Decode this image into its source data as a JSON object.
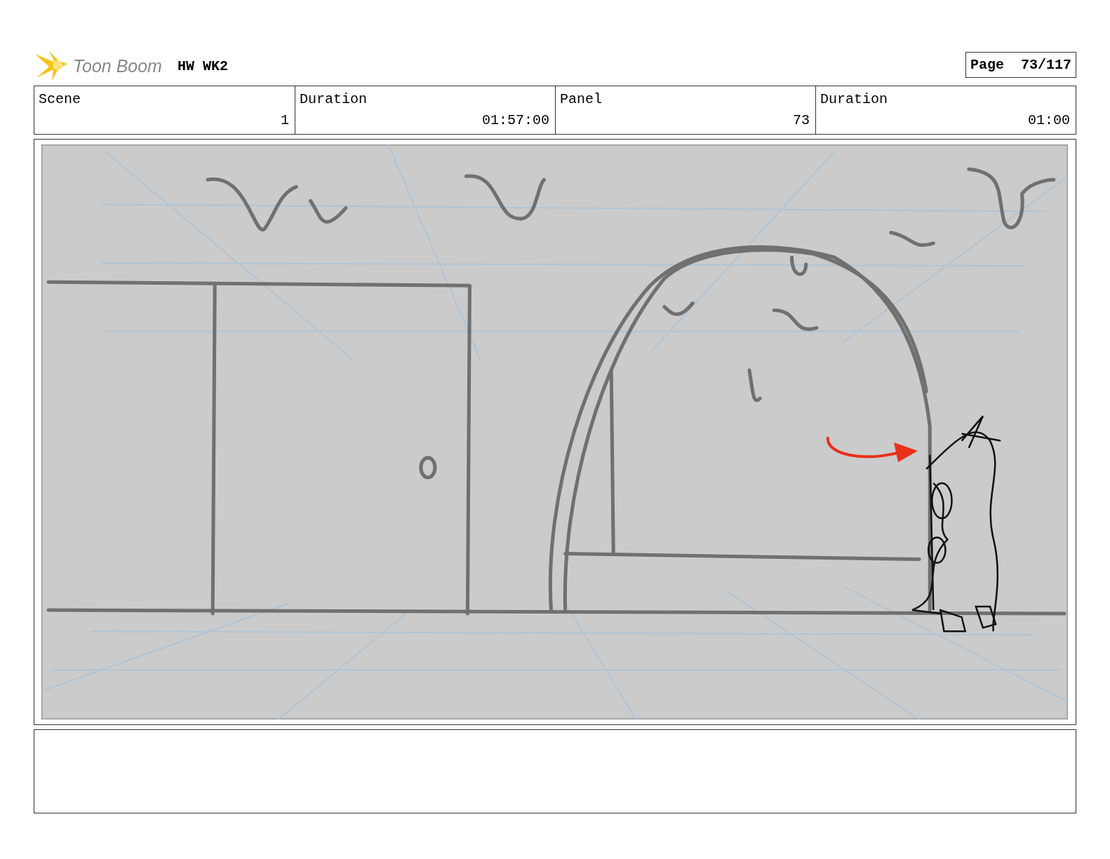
{
  "header": {
    "logo": "Toon Boom",
    "project": "HW WK2",
    "page_label": "Page",
    "page": "73/117"
  },
  "info": {
    "labels": [
      "Scene",
      "Duration",
      "Panel",
      "Duration"
    ],
    "values": [
      "1",
      "01:57:00",
      "73",
      "01:00"
    ]
  }
}
